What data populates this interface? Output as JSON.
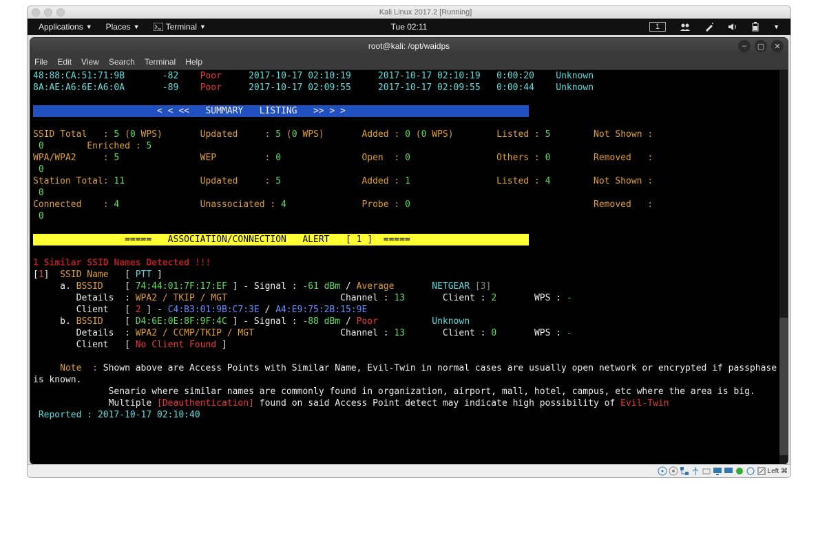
{
  "vm": {
    "title": "Kali Linux 2017.2 [Running]"
  },
  "gnome": {
    "apps": "Applications",
    "places": "Places",
    "terminal": "Terminal",
    "clock": "Tue 02:11",
    "workspace": "1"
  },
  "termwin": {
    "title": "root@kali: /opt/waidps",
    "menu": {
      "file": "File",
      "edit": "Edit",
      "view": "View",
      "search": "Search",
      "terminal": "Terminal",
      "help": "Help"
    }
  },
  "rows": [
    {
      "mac": "48:88:CA:51:71:9B",
      "pwr": "-82",
      "qual": "Poor",
      "first": "2017-10-17 02:10:19",
      "last": "2017-10-17 02:10:19",
      "el": "0:00:20",
      "vendor": "Unknown"
    },
    {
      "mac": "8A:AE:A6:6E:A6:0A",
      "pwr": "-89",
      "qual": "Poor",
      "first": "2017-10-17 02:09:55",
      "last": "2017-10-17 02:09:55",
      "el": "0:00:44",
      "vendor": "Unknown"
    }
  ],
  "summary_header": "< < <<   SUMMARY   LISTING   >> > >",
  "summary": {
    "ssid_total": "5",
    "ssid_wps": "0",
    "updated": "5",
    "updated_wps": "0",
    "added": "0",
    "added_wps": "0",
    "listed": "5",
    "not_shown": "0",
    "enriched": "5",
    "wpa": "5",
    "wep": "0",
    "open": "0",
    "others": "0",
    "removed": "0",
    "sta_total": "11",
    "sta_updated": "5",
    "sta_added": "1",
    "sta_listed": "4",
    "sta_not_shown": "0",
    "connected": "4",
    "unassoc": "4",
    "probe": "0",
    "sta_removed": "0"
  },
  "alert_header": "=====   ASSOCIATION/CONNECTION   ALERT   [ 1 ]  =====",
  "ssid_alert": {
    "headline": "1 Similar SSID Names Detected !!!",
    "idx": "1",
    "ssid_label": "SSID Name",
    "ssid": "PTT",
    "a": {
      "label": "a.",
      "bssid_label": "BSSID",
      "bssid": "74:44:01:7F:17:EF",
      "signal": "-61 dBm",
      "quality": "Average",
      "vendor": "NETGEAR",
      "vendor_n": "3",
      "enc": "WPA2 / TKIP / MGT",
      "channel": "13",
      "client": "2",
      "wps": "-",
      "clients_n": "2",
      "client1": "C4:B3:01:9B:C7:3E",
      "client2": "A4:E9:75:2B:15:9E"
    },
    "b": {
      "label": "b.",
      "bssid_label": "BSSID",
      "bssid": "D4:6E:0E:8F:9F:4C",
      "signal": "-88 dBm",
      "quality": "Poor",
      "vendor": "Unknown",
      "enc": "WPA2 / CCMP/TKIP / MGT",
      "channel": "13",
      "client": "0",
      "wps": "-",
      "noclient": "No Client Found"
    },
    "note_label": "Note  :",
    "note1": "Shown above are Access Points with Similar Name, Evil-Twin in normal cases are usually open network or encrypted if passphase is known.",
    "note2": "Senario where similar names are commonly found in organization, airport, mall, hotel, campus, etc where the area is big.",
    "note3_pre": "Multiple ",
    "deauth": "[Deauthentication]",
    "note3_post": " found on said Access Point detect may indicate high possibility of ",
    "eviltwin": "Evil-Twin",
    "reported_label": "Reported :",
    "reported": "2017-10-17 02:10:40"
  },
  "status_right": "Left ⌘"
}
